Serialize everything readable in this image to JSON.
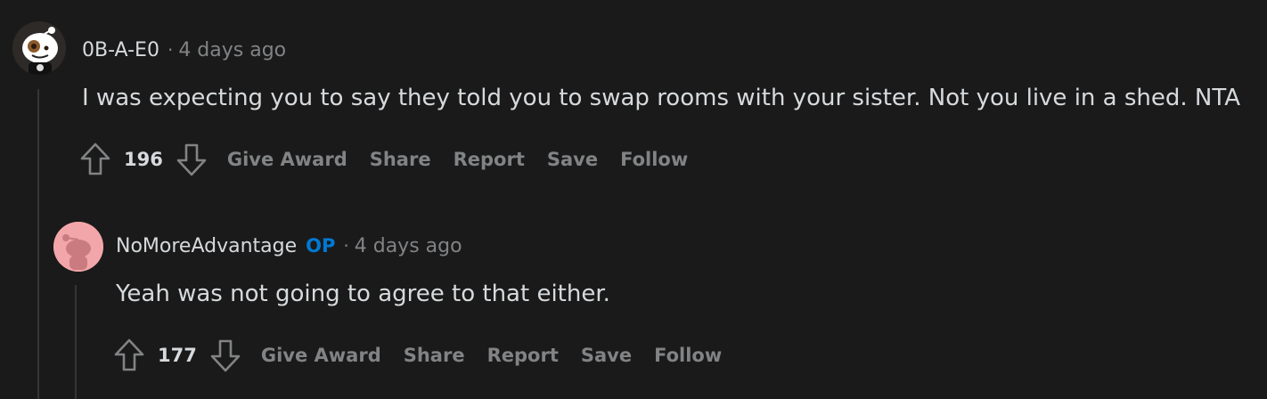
{
  "comments": [
    {
      "username": "0B-A-E0",
      "separator": "·",
      "time": "4 days ago",
      "body": "I was expecting you to say they told you to swap rooms with your sister. Not you live in a shed. NTA",
      "score": "196",
      "actions": {
        "give_award": "Give Award",
        "share": "Share",
        "report": "Report",
        "save": "Save",
        "follow": "Follow"
      }
    },
    {
      "username": "NoMoreAdvantage",
      "op_badge": "OP",
      "separator": "·",
      "time": "4 days ago",
      "body": "Yeah was not going to agree to that either.",
      "score": "177",
      "actions": {
        "give_award": "Give Award",
        "share": "Share",
        "report": "Report",
        "save": "Save",
        "follow": "Follow"
      }
    }
  ],
  "colors": {
    "background": "#1a1a1b",
    "text": "#d7dadc",
    "muted": "#818384",
    "op_blue": "#0079d3",
    "thread_line": "#343536",
    "reply_avatar_bg": "#f3a6a9"
  }
}
